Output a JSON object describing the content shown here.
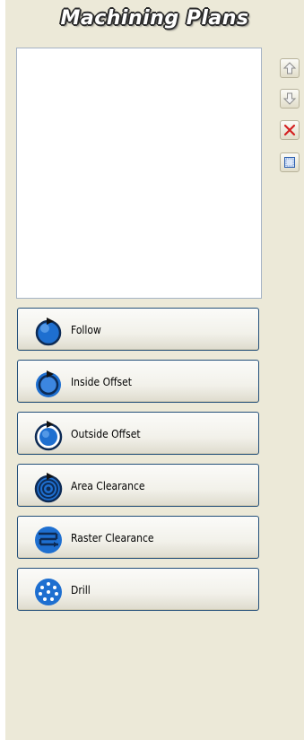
{
  "panel": {
    "title": "Machining Plans"
  },
  "toolbar": {
    "buttons": [
      {
        "icon": "move-up-icon"
      },
      {
        "icon": "move-down-icon"
      },
      {
        "icon": "delete-icon"
      },
      {
        "icon": "properties-icon"
      }
    ]
  },
  "operations": [
    {
      "label": "Follow",
      "icon": "follow-icon"
    },
    {
      "label": "Inside Offset",
      "icon": "inside-offset-icon"
    },
    {
      "label": "Outside Offset",
      "icon": "outside-offset-icon"
    },
    {
      "label": "Area Clearance",
      "icon": "area-clearance-icon"
    },
    {
      "label": "Raster Clearance",
      "icon": "raster-clearance-icon"
    },
    {
      "label": "Drill",
      "icon": "drill-icon"
    }
  ],
  "colors": {
    "panel_bg": "#ece9d8",
    "button_border": "#24507a",
    "icon_blue": "#1e6fd0",
    "delete_red": "#d42020"
  }
}
